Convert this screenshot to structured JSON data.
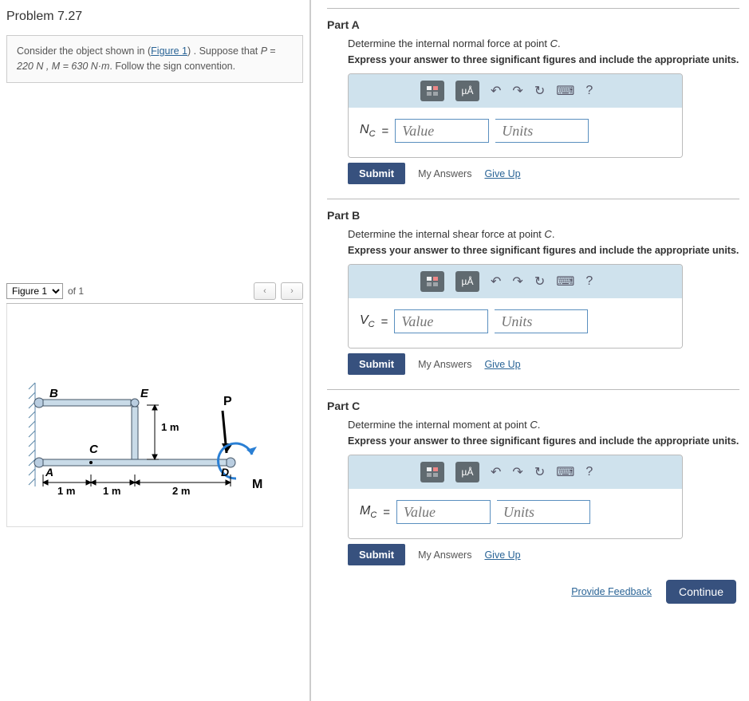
{
  "problem": {
    "title": "Problem 7.27",
    "intro_pre": "Consider the object shown in (",
    "intro_link": "Figure 1",
    "intro_post": ") . Suppose that ",
    "intro_eq": "P = 220 N , M = 630 N·m",
    "intro_tail": ". Follow the sign convention."
  },
  "figure": {
    "select_label": "Figure 1",
    "of_text": "of 1",
    "labels": {
      "B": "B",
      "E": "E",
      "P": "P",
      "C": "C",
      "A": "A",
      "D": "D",
      "M": "M",
      "one_m": "1 m",
      "two_m": "2 m"
    }
  },
  "parts": [
    {
      "title": "Part A",
      "desc_pre": "Determine the internal normal force at point ",
      "desc_var": "C",
      "desc_post": ".",
      "instr": "Express your answer to three significant figures and include the appropriate units.",
      "var_html": "N",
      "sub": "C",
      "value_ph": "Value",
      "units_ph": "Units"
    },
    {
      "title": "Part B",
      "desc_pre": "Determine the internal shear force at point ",
      "desc_var": "C",
      "desc_post": ".",
      "instr": "Express your answer to three significant figures and include the appropriate units.",
      "var_html": "V",
      "sub": "C",
      "value_ph": "Value",
      "units_ph": "Units"
    },
    {
      "title": "Part C",
      "desc_pre": "Determine the internal moment at point ",
      "desc_var": "C",
      "desc_post": ".",
      "instr": "Express your answer to three significant figures and include the appropriate units.",
      "var_html": "M",
      "sub": "C",
      "value_ph": "Value",
      "units_ph": "Units"
    }
  ],
  "buttons": {
    "submit": "Submit",
    "my_answers": "My Answers",
    "give_up": "Give Up",
    "provide_feedback": "Provide Feedback",
    "continue": "Continue",
    "uA": "µÅ",
    "help": "?"
  }
}
